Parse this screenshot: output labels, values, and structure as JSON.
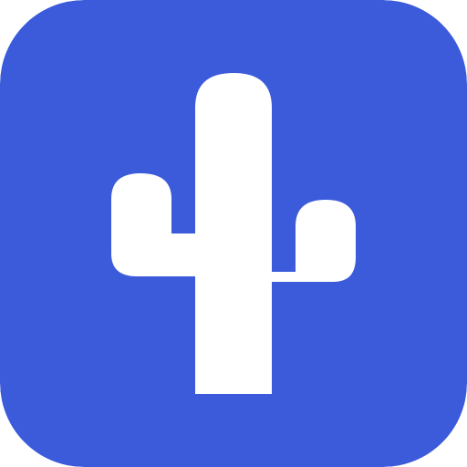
{
  "icon": {
    "name": "cactus-icon",
    "background_color": "#3B5BDB",
    "glyph_color": "#FFFFFF"
  }
}
